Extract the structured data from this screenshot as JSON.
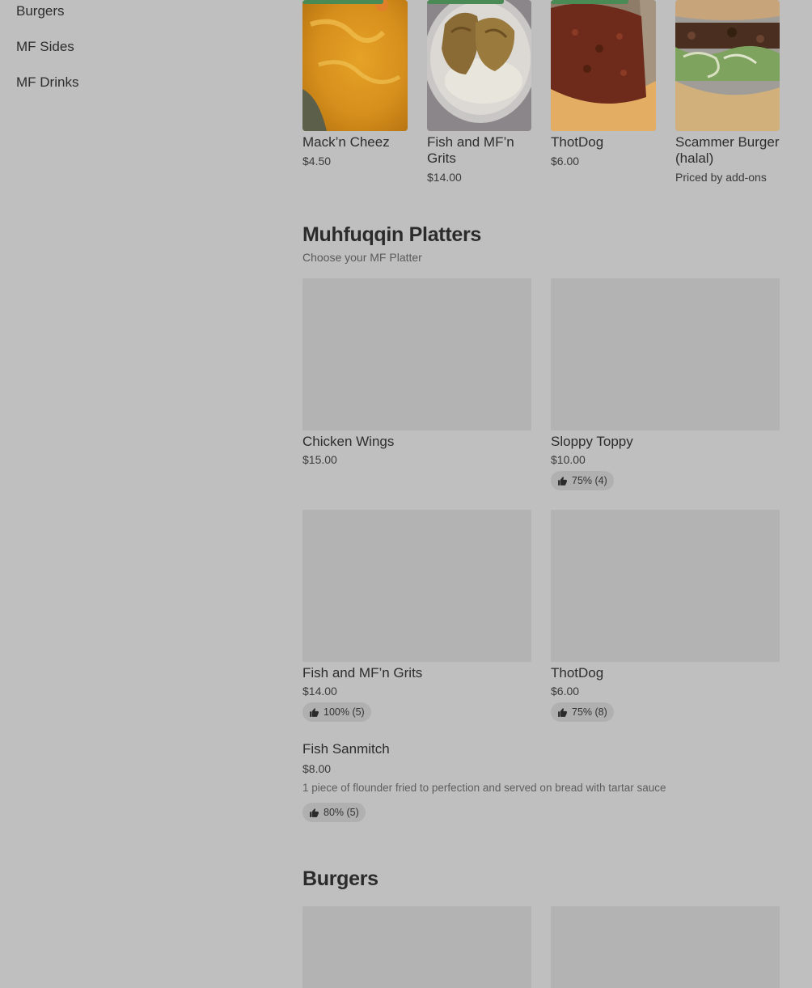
{
  "sidebar": {
    "items": [
      {
        "label": "Burgers"
      },
      {
        "label": "MF Sides"
      },
      {
        "label": "MF Drinks"
      }
    ]
  },
  "featured": {
    "items": [
      {
        "name": "Mack’n Cheez",
        "price": "$4.50"
      },
      {
        "name": "Fish and MF’n Grits",
        "price": "$14.00"
      },
      {
        "name": "ThotDog",
        "price": "$6.00"
      },
      {
        "name": "Scammer Burger (halal)",
        "price": "Priced by add-ons"
      }
    ]
  },
  "platters": {
    "title": "Muhfuqqin Platters",
    "subtitle": "Choose your MF Platter",
    "cards": [
      {
        "name": "Chicken Wings",
        "price": "$15.00",
        "rating": ""
      },
      {
        "name": "Sloppy Toppy",
        "price": "$10.00",
        "rating": "75% (4)"
      },
      {
        "name": "Fish and MF’n Grits",
        "price": "$14.00",
        "rating": "100% (5)"
      },
      {
        "name": "ThotDog",
        "price": "$6.00",
        "rating": "75% (8)"
      }
    ],
    "list_item": {
      "name": "Fish Sanmitch",
      "price": "$8.00",
      "description": "1 piece of flounder fried to perfection and served on bread with tartar sauce",
      "rating": "80% (5)"
    }
  },
  "burgers": {
    "title": "Burgers"
  },
  "icons": {
    "thumbs_up": "thumbs-up-icon"
  },
  "colors": {
    "overlay_background": "#bfbfbf",
    "placeholder": "#b3b3b3",
    "badge": "#b0b0b0",
    "accent_green": "#4a8a55"
  }
}
